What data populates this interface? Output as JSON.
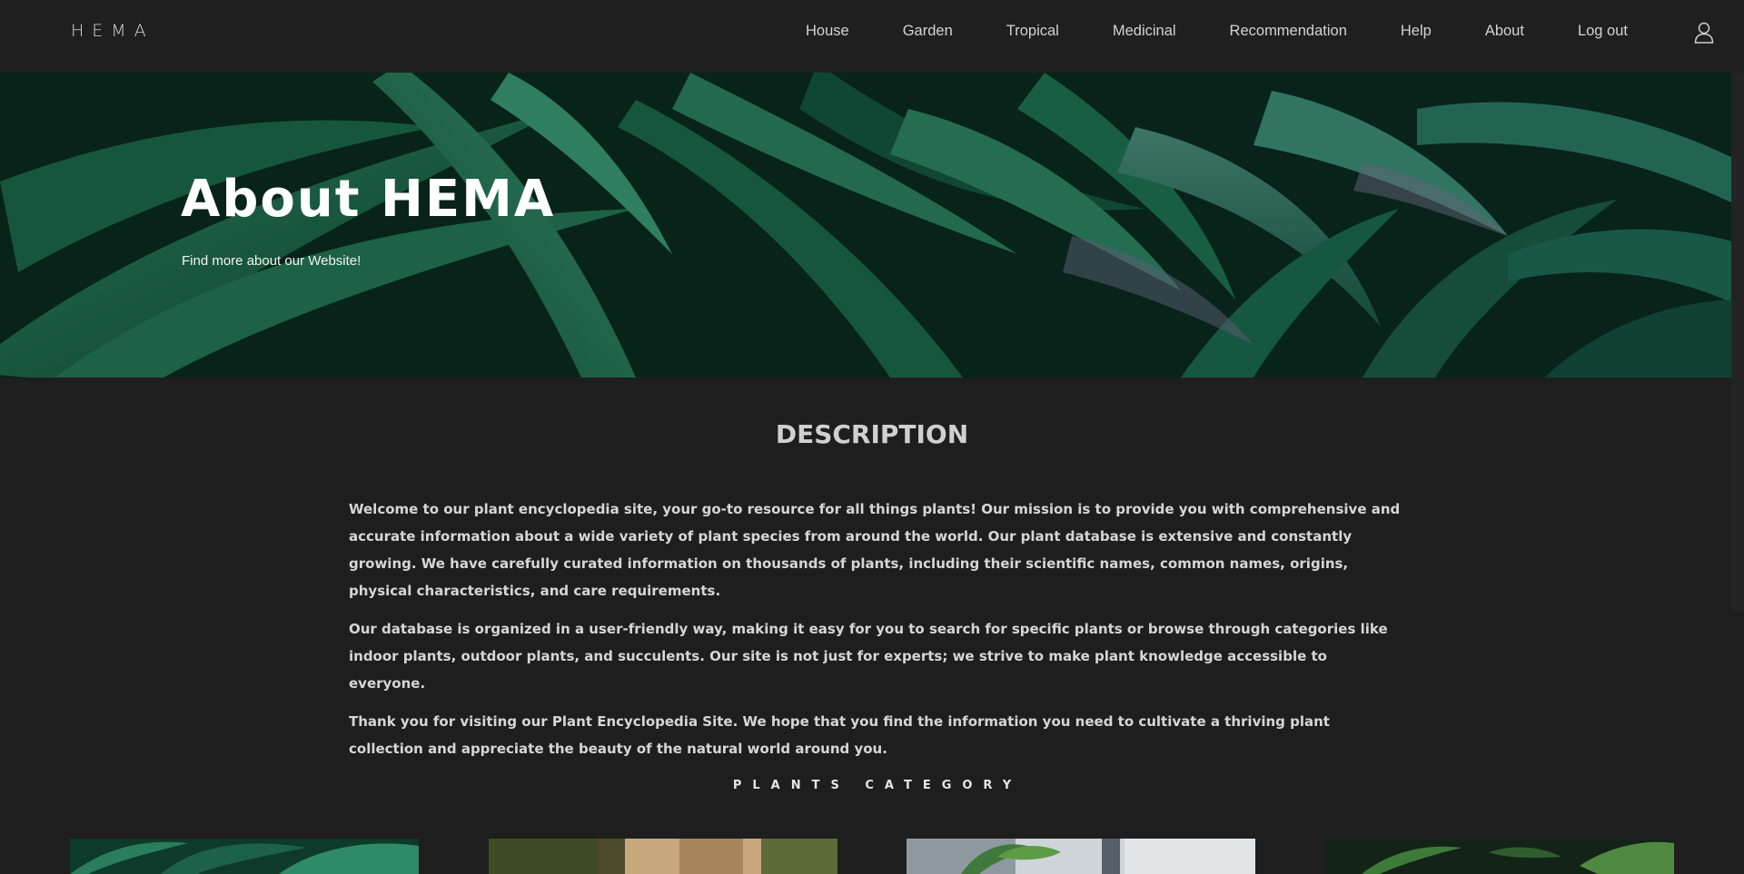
{
  "header": {
    "logo": "HEMA",
    "nav": [
      "House",
      "Garden",
      "Tropical",
      "Medicinal",
      "Recommendation",
      "Help",
      "About",
      "Log out"
    ],
    "user_icon": "user-icon"
  },
  "hero": {
    "title": "About HEMA",
    "subtitle": "Find more about our Website!"
  },
  "description": {
    "heading": "DESCRIPTION",
    "paragraphs": [
      "Welcome to our plant encyclopedia site, your go-to resource for all things plants! Our mission is to provide you with comprehensive and accurate information about a wide variety of plant species from around the world. Our plant database is extensive and constantly growing. We have carefully curated information on thousands of plants, including their scientific names, common names, origins, physical characteristics, and care requirements.",
      "Our database is organized in a user-friendly way, making it easy for you to search for specific plants or browse through categories like indoor plants, outdoor plants, and succulents. Our site is not just for experts; we strive to make plant knowledge accessible to everyone.",
      "Thank you for visiting our Plant Encyclopedia Site. We hope that you find the information you need to cultivate a thriving plant collection and appreciate the beauty of the natural world around you."
    ]
  },
  "categories": {
    "title": "PLANTS CATEGORY"
  },
  "colors": {
    "background": "#1e1e1e",
    "nav_bg": "#1f1f1f",
    "leaf_dark": "#0d3a2c",
    "leaf_mid": "#1a6b4f",
    "leaf_light": "#3f9a78"
  }
}
